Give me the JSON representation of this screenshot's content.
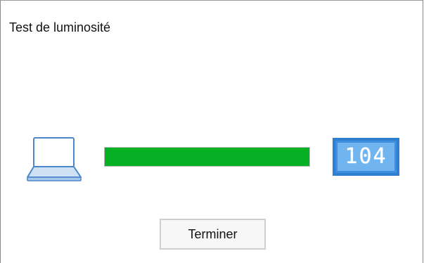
{
  "dialog": {
    "title": "Test de luminosité",
    "brightness_level": 104,
    "brightness_display": "104",
    "progress_fraction": 1.0,
    "finish_button_label": "Terminer",
    "device_icon": "laptop-icon"
  },
  "colors": {
    "progress_fill": "#06b025",
    "display_background": "#3d8ee0",
    "display_face": "#70b4f0"
  }
}
